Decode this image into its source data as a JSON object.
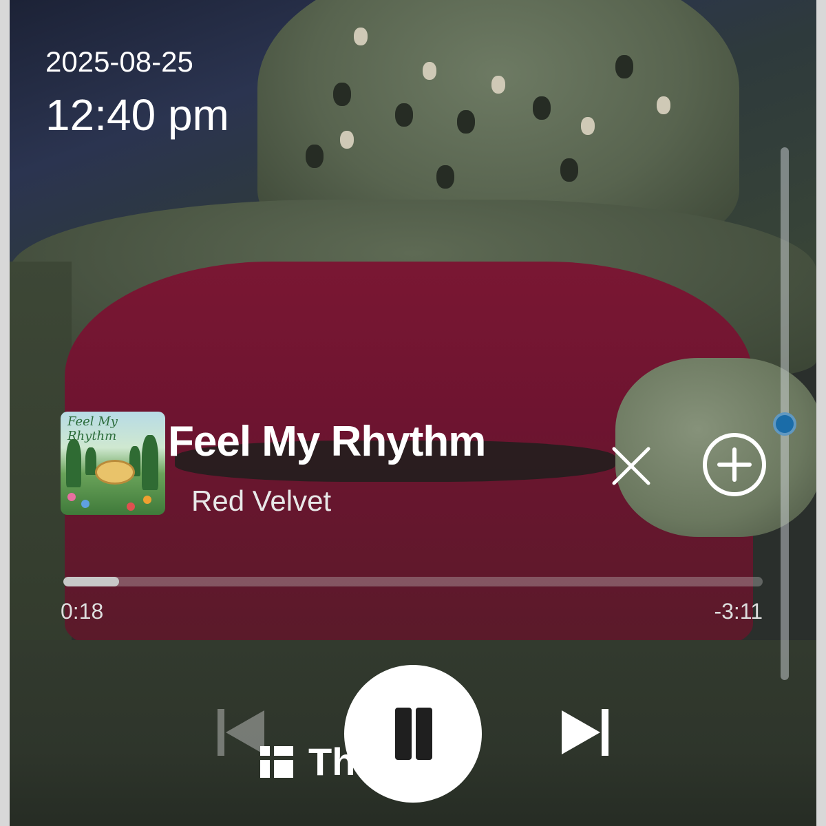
{
  "status": {
    "date": "2025-08-25",
    "time": "12:40 pm"
  },
  "now_playing": {
    "title": "Feel My Rhythm",
    "artist": "Red Velvet",
    "album_art_icon": "album-cover-garden-icon",
    "album_art_text": "Feel My Rhythm"
  },
  "playback": {
    "elapsed": "0:18",
    "remaining": "-3:11",
    "progress_fraction": 0.08
  },
  "volume": {
    "level_fraction": 0.48,
    "knob_color": "#1a6ca8"
  },
  "controls": {
    "close_icon": "close-icon",
    "add_icon": "add-circle-icon",
    "prev_icon": "skip-previous-icon",
    "pause_icon": "pause-icon",
    "next_icon": "skip-next-icon"
  },
  "watermark": {
    "text": "Threads",
    "logo_icon": "app-logo-icon"
  }
}
